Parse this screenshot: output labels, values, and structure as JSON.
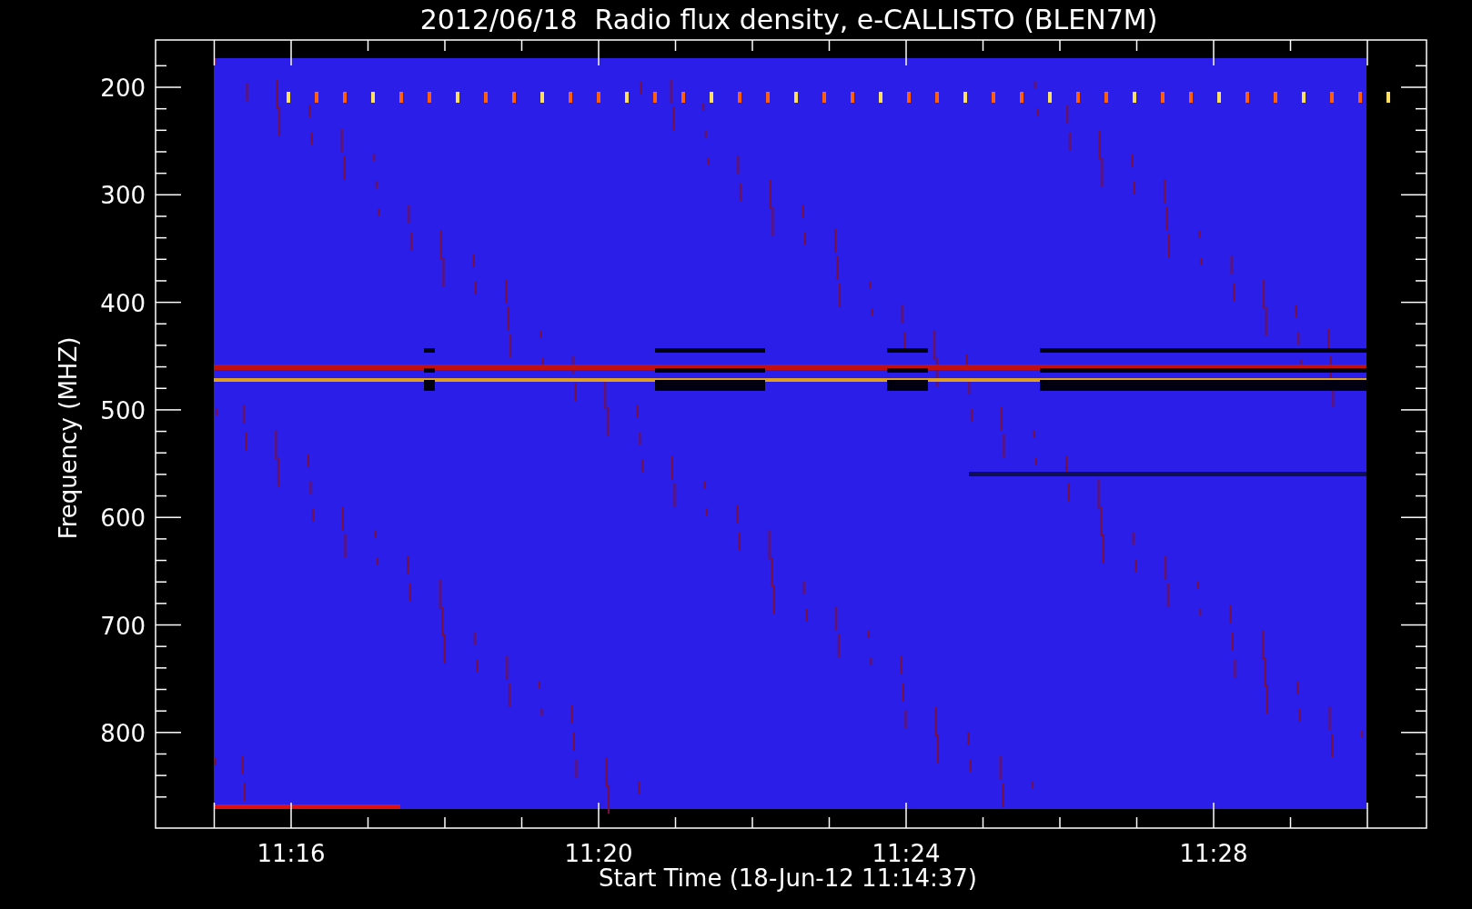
{
  "plot": {
    "title": "2012/06/18  Radio flux density, e-CALLISTO (BLEN7M)",
    "xlabel": "Start Time (18-Jun-12 11:14:37)",
    "ylabel": "Frequency (MHZ)",
    "yticks": [
      "200",
      "300",
      "400",
      "500",
      "600",
      "700",
      "800"
    ],
    "xticks": [
      "11:16",
      "11:20",
      "11:24",
      "11:28"
    ]
  }
}
